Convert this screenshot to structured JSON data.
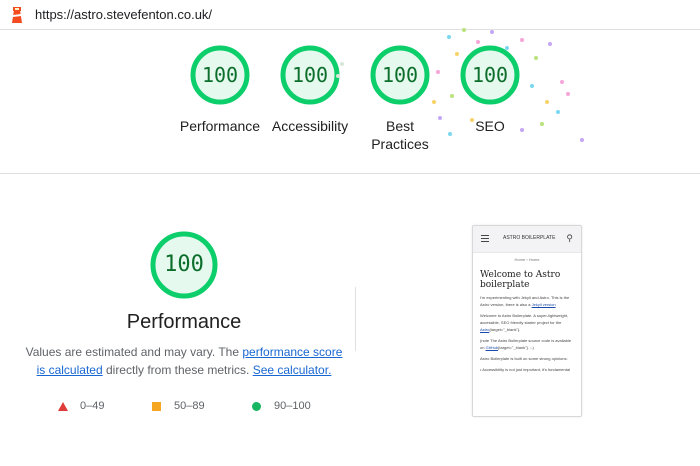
{
  "url": "https://astro.stevefenton.co.uk/",
  "colors": {
    "pass": "#0cce6b",
    "pass_text": "#0c6e2b",
    "pass_bg": "#e6f9ee",
    "average": "#f5a623",
    "fail": "#e03b3b",
    "link": "#1967d2"
  },
  "summary": [
    {
      "score": "100",
      "label": "Performance"
    },
    {
      "score": "100",
      "label": "Accessibility"
    },
    {
      "score": "100",
      "label": "Best Practices"
    },
    {
      "score": "100",
      "label": "SEO"
    }
  ],
  "performance": {
    "score": "100",
    "title": "Performance",
    "desc_part1": "Values are estimated and may vary. The ",
    "desc_link1": "performance score is calculated",
    "desc_part2": " directly from these metrics. ",
    "desc_link2": "See calculator."
  },
  "legend": [
    {
      "icon": "triangle-icon",
      "label": "0–49"
    },
    {
      "icon": "square-icon",
      "label": "50–89"
    },
    {
      "icon": "circle-icon",
      "label": "90–100"
    }
  ],
  "screenshot": {
    "brand": "ASTRO BOILERPLATE",
    "breadcrumb": "Home › Home",
    "heading": "Welcome to Astro boilerplate",
    "p1": "I'm experimenting with Jekyll and Astro. This is the Astro version, there is also a",
    "p1_link": "Jekyll version",
    "p2": "Welcome to Astro Boilerplate. A super-lightweight, accessible, SEO friendly starter project for the",
    "p2_link": "Astro",
    "p2_end": "{target=\"_blank\"}.",
    "p3": "(note The Astro Boilerplate source code is available on",
    "p3_link": "GitHub",
    "p3_end": "{target=\"_blank\"}. :-)",
    "p4": "Astro Boilerplate is built on some strong opinions:",
    "p5": "• Accessibility is not just important, it's fundamental"
  }
}
